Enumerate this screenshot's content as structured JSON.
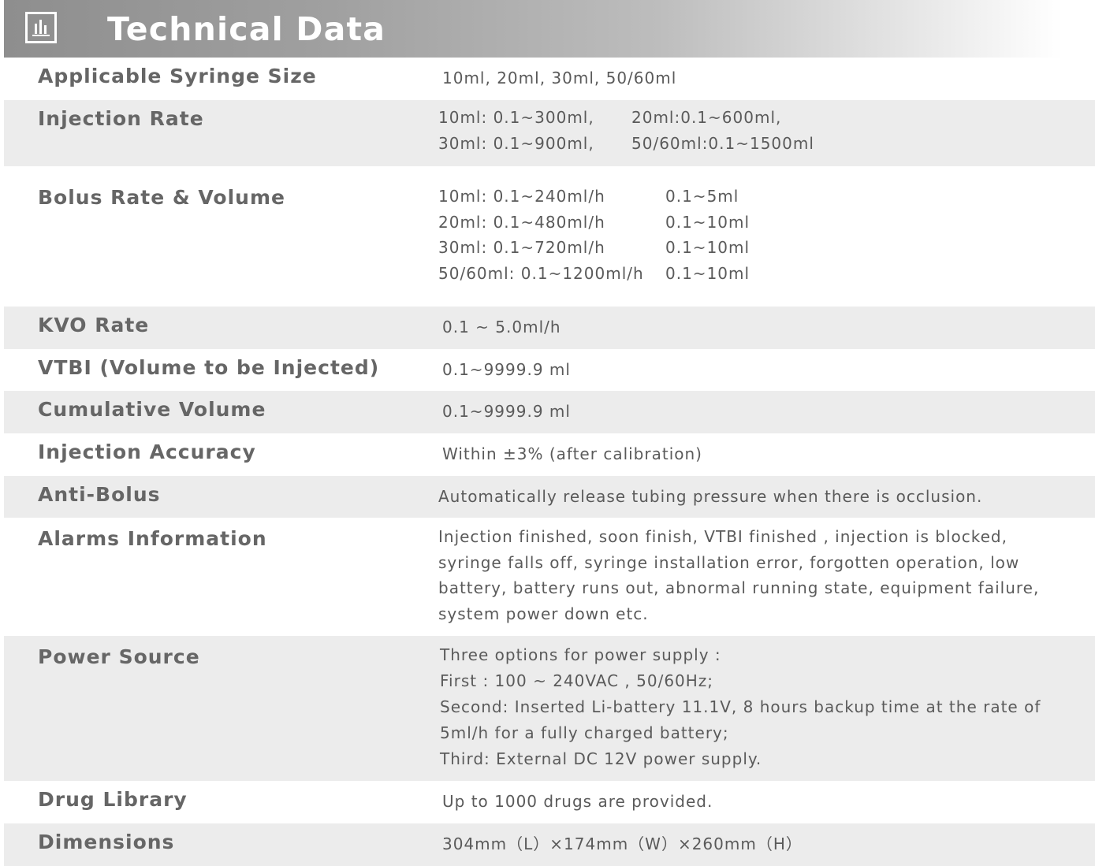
{
  "header": {
    "title": "Technical Data",
    "icon": "bar-chart-icon"
  },
  "specs": {
    "syringe_size": {
      "label": "Applicable Syringe Size",
      "value": "10ml, 20ml, 30ml, 50/60ml"
    },
    "injection_rate": {
      "label": "Injection Rate",
      "col1": [
        "10ml: 0.1~300ml,",
        "30ml: 0.1~900ml,"
      ],
      "col2": [
        "20ml:0.1~600ml,",
        "50/60ml:0.1~1500ml"
      ]
    },
    "bolus": {
      "label": "Bolus Rate & Volume",
      "rates": [
        "10ml:  0.1~240ml/h",
        "20ml: 0.1~480ml/h",
        "30ml:  0.1~720ml/h",
        "50/60ml: 0.1~1200ml/h"
      ],
      "volumes": [
        "0.1~5ml",
        "0.1~10ml",
        "0.1~10ml",
        "0.1~10ml"
      ]
    },
    "kvo": {
      "label": "KVO Rate",
      "value": "0.1 ~ 5.0ml/h"
    },
    "vtbi": {
      "label": "VTBI (Volume to be Injected)",
      "value": "0.1~9999.9 ml"
    },
    "cumulative": {
      "label": "Cumulative Volume",
      "value": "0.1~9999.9 ml"
    },
    "accuracy": {
      "label": "Injection Accuracy",
      "value": "Within ±3% (after calibration)"
    },
    "anti_bolus": {
      "label": "Anti-Bolus",
      "value": "Automatically release tubing pressure when there is occlusion."
    },
    "alarms": {
      "label": "Alarms Information",
      "lines": [
        "Injection finished, soon finish, VTBI finished , injection is blocked,",
        "syringe falls off, syringe installation error, forgotten operation, low",
        "battery, battery runs out, abnormal running state, equipment failure,",
        "system power down etc."
      ]
    },
    "power": {
      "label": "Power Source",
      "lines": [
        "Three options for power supply :",
        "First : 100 ~ 240VAC , 50/60Hz;",
        "Second: Inserted Li-battery 11.1V,  8 hours backup time at the rate of",
        "5ml/h for a fully charged battery;",
        "Third: External DC 12V power supply."
      ]
    },
    "drug_library": {
      "label": "Drug Library",
      "value": "Up to 1000 drugs are provided."
    },
    "dimensions": {
      "label": "Dimensions",
      "value": "304mm（L）×174mm（W）×260mm（H）"
    }
  }
}
